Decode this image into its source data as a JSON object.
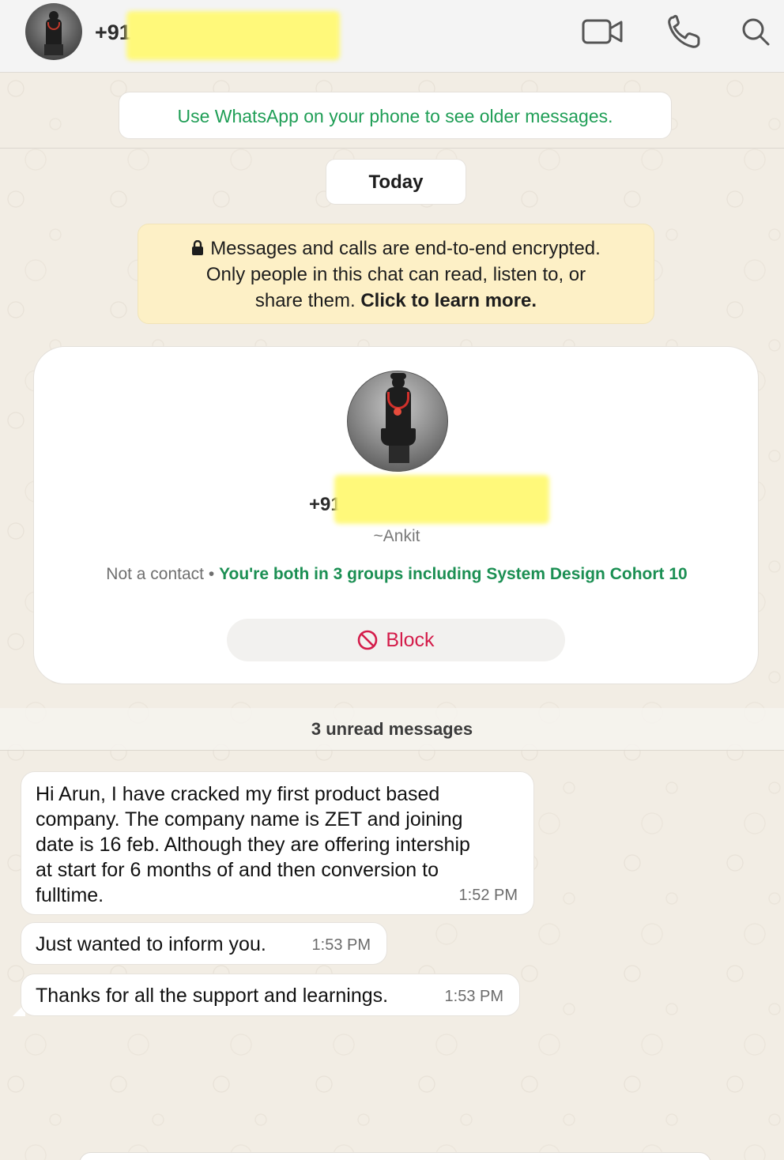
{
  "header": {
    "title_prefix": "+91",
    "icons": [
      "video-call-icon",
      "voice-call-icon",
      "search-icon"
    ]
  },
  "banner": {
    "older_messages": "Use WhatsApp on your phone to see older messages.",
    "date_divider": "Today"
  },
  "encryption": {
    "line1": "Messages and calls are end-to-end encrypted.",
    "line2": "Only people in this chat can read, listen to, or",
    "line3_prefix": "share them.",
    "line3_link": "Click to learn more."
  },
  "contact_card": {
    "phone_prefix": "+91",
    "alias": "~Ankit",
    "status": "Not a contact",
    "separator": "•",
    "groups_text": "You're both in 3 groups including System Design Cohort 10",
    "block_label": "Block"
  },
  "unread": "3 unread messages",
  "messages": [
    {
      "lines": [
        "Hi Arun, I have cracked my first product based",
        "company. The company name is ZET and joining",
        "date is 16 feb. Although they are offering intership",
        "at start for 6 months of and then conversion to",
        "fulltime."
      ],
      "time": "1:52 PM"
    },
    {
      "lines": [
        "Just wanted to inform you."
      ],
      "time": "1:53 PM"
    },
    {
      "lines": [
        "Thanks for all the support and learnings."
      ],
      "time": "1:53 PM"
    }
  ],
  "colors": {
    "accent_green": "#1b8f53",
    "link_green": "#1f9e56",
    "block_red": "#d41c4a",
    "encryption_bg": "#fdf0c6"
  }
}
